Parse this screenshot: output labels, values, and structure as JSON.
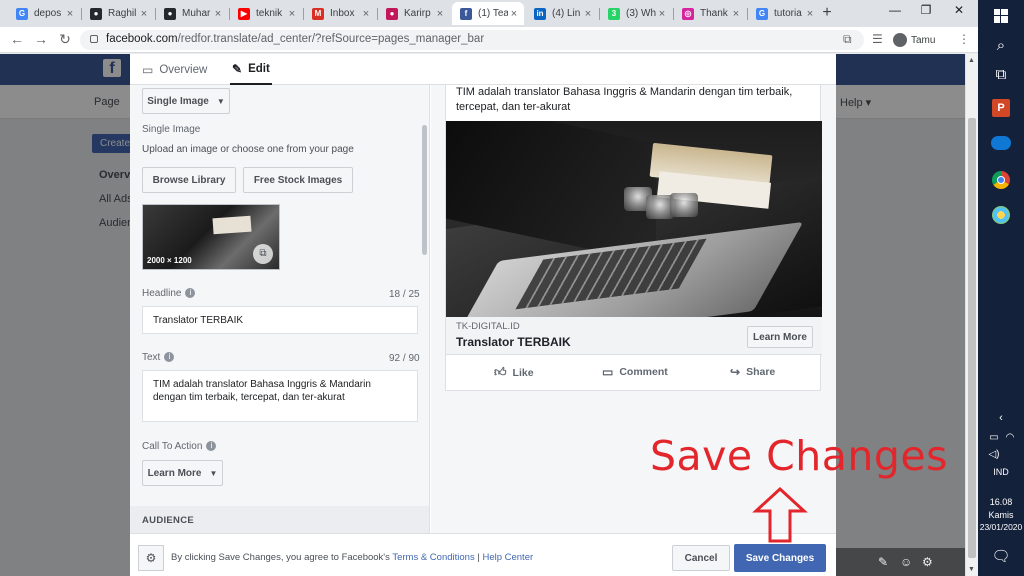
{
  "browser": {
    "tabs": [
      {
        "title": "depos",
        "icon": "google-icon",
        "color": "#4285f4",
        "glyph": "G"
      },
      {
        "title": "Raghil",
        "icon": "github-icon",
        "color": "#24292e",
        "glyph": "●"
      },
      {
        "title": "Muhar",
        "icon": "github-icon",
        "color": "#24292e",
        "glyph": "●"
      },
      {
        "title": "teknik",
        "icon": "youtube-icon",
        "color": "#ff0000",
        "glyph": "▶"
      },
      {
        "title": "Inbox",
        "icon": "gmail-icon",
        "color": "#d93025",
        "glyph": "M"
      },
      {
        "title": "Karirp",
        "icon": "karirpad-icon",
        "color": "#c2185b",
        "glyph": "●"
      },
      {
        "title": "(1) Tea",
        "icon": "facebook-icon",
        "color": "#3b5998",
        "glyph": "f"
      },
      {
        "title": "(4) Lin",
        "icon": "linkedin-icon",
        "color": "#0a66c2",
        "glyph": "in"
      },
      {
        "title": "(3) Wh",
        "icon": "whatsapp-icon",
        "color": "#25d366",
        "glyph": "3"
      },
      {
        "title": "Thank",
        "icon": "instagram-icon",
        "color": "#d6249f",
        "glyph": "◎"
      },
      {
        "title": "tutoria",
        "icon": "google-icon",
        "color": "#4285f4",
        "glyph": "G"
      }
    ],
    "url_domain": "facebook.com",
    "url_path": "/redfor.translate/ad_center/?refSource=pages_manager_bar",
    "profile_name": "Tamu"
  },
  "background_page": {
    "nav_page": "Page",
    "nav_help": "Help",
    "create_label": "Create",
    "sidebar": [
      "Overvi",
      "All Ads",
      "Audien"
    ]
  },
  "modal": {
    "tabs": {
      "overview": "Overview",
      "edit": "Edit"
    },
    "format_dropdown": "Single Image",
    "section_title": "Single Image",
    "upload_hint": "Upload an image or choose one from your page",
    "browse_library": "Browse Library",
    "free_stock": "Free Stock Images",
    "image_dims": "2000 × 1200",
    "headline_label": "Headline",
    "headline_count": "18 / 25",
    "headline_value": "Translator TERBAIK",
    "text_label": "Text",
    "text_count": "92 / 90",
    "text_value": "TIM adalah translator Bahasa Inggris & Mandarin dengan tim terbaik, tercepat, dan ter-akurat",
    "cta_label": "Call To Action",
    "cta_value": "Learn More",
    "audience_header": "AUDIENCE",
    "preview": {
      "body_text": "TIM adalah translator Bahasa Inggris & Mandarin dengan tim terbaik, tercepat, dan ter-akurat",
      "domain": "TK-DIGITAL.ID",
      "headline": "Translator TERBAIK",
      "cta": "Learn More",
      "like": "Like",
      "comment": "Comment",
      "share": "Share"
    },
    "footer": {
      "consent_prefix": "By clicking Save Changes, you agree to Facebook's",
      "terms_link": "Terms & Conditions",
      "separator": "|",
      "help_link": "Help Center",
      "cancel": "Cancel",
      "save": "Save Changes"
    }
  },
  "annotation": {
    "text": "Save Changes",
    "color": "#e3262b"
  },
  "taskbar": {
    "lang": "IND",
    "time": "16.08",
    "day": "Kamis",
    "date": "23/01/2020"
  },
  "colors": {
    "fb_blue": "#3b5998",
    "button_blue": "#4267b2",
    "taskbar": "#14213b"
  }
}
